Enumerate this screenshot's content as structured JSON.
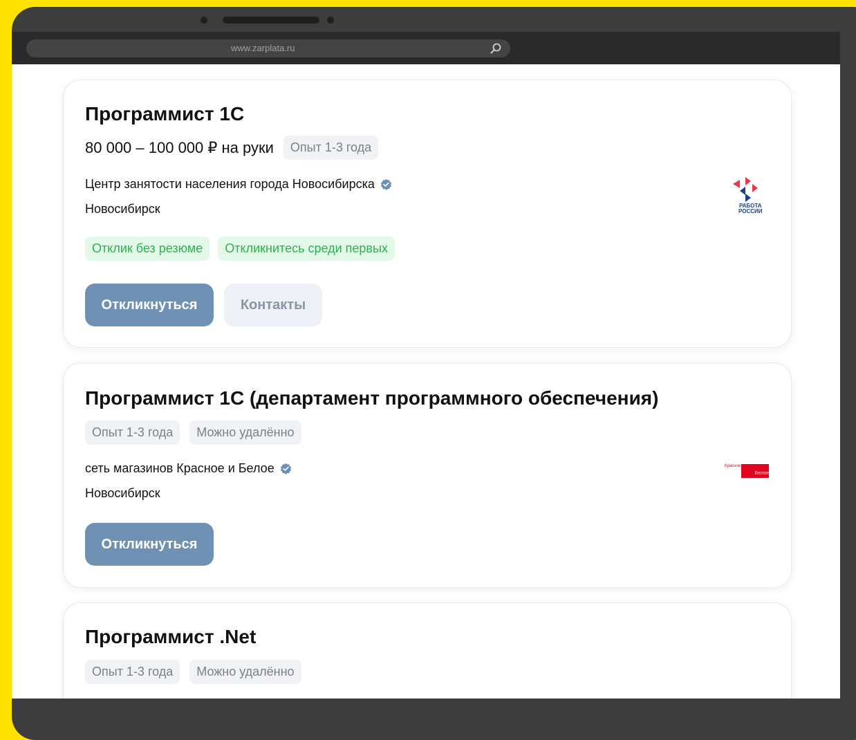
{
  "browser": {
    "url": "www.zarplata.ru",
    "search_icon": "search-icon"
  },
  "vacancies": [
    {
      "title": "Программист 1С",
      "salary": "80 000 – 100 000 ₽ на руки",
      "tags": [
        "Опыт 1-3 года"
      ],
      "company": "Центр занятости населения города Новосибирска",
      "city": "Новосибирск",
      "badges": [
        "Отклик без резюме",
        "Откликнитесь среди первых"
      ],
      "primary_button": "Откликнуться",
      "secondary_button": "Контакты",
      "logo_text": [
        "РАБОТА",
        "РОССИИ"
      ]
    },
    {
      "title": "Программист 1С (департамент программного обеспечения)",
      "tags": [
        "Опыт 1-3 года",
        "Можно удалённо"
      ],
      "company": "сеть магазинов Красное и Белое",
      "city": "Новосибирск",
      "primary_button": "Откликнуться",
      "logo_text": [
        "Красное",
        "Белое"
      ]
    },
    {
      "title": "Программист .Net",
      "tags": [
        "Опыт 1-3 года",
        "Можно удалённо"
      ]
    }
  ],
  "colors": {
    "background": "#FFE100",
    "primary_button": "#6f91b3",
    "green_badge_text": "#2bb34e",
    "verified": "#6a8fb5"
  }
}
